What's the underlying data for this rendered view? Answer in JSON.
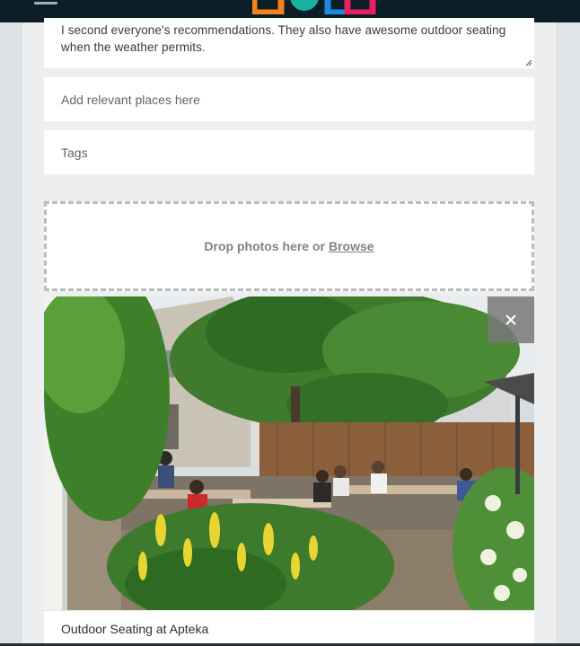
{
  "header": {
    "logo_colors": [
      "#f5821f",
      "#17b3a3",
      "#1e88e5",
      "#e91e63",
      "#3f51b5"
    ]
  },
  "form": {
    "comment_text": "I second everyone's recommendations. They also have awesome outdoor seating when the weather permits.",
    "places_placeholder": "Add relevant places here",
    "tags_placeholder": "Tags",
    "dropzone_text": "Drop photos here or",
    "dropzone_browse": "Browse"
  },
  "photo": {
    "caption": "Outdoor Seating at Apteka",
    "remove_icon": "close-icon"
  }
}
